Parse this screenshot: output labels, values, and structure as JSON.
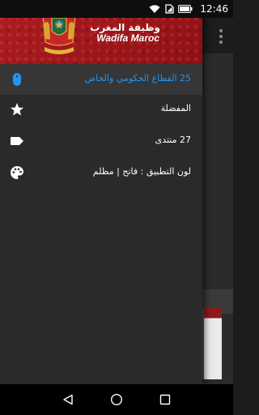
{
  "status_bar": {
    "time": "12:46",
    "icons": [
      "wifi-icon",
      "sim-signal-icon",
      "battery-icon"
    ]
  },
  "drawer": {
    "header": {
      "title_ar": "وظيفة المغرب",
      "title_en": "Wadifa Maroc",
      "logo": "coat-of-arms-icon"
    },
    "items": [
      {
        "label": "25  القطاع الحكومي والخاص",
        "icon": "mouse-icon",
        "selected": true
      },
      {
        "label": "المفضلة",
        "icon": "star-icon",
        "selected": false
      },
      {
        "label": "27  منتدى",
        "icon": "tag-icon",
        "selected": false
      },
      {
        "label": "لون التطبيق : فاتح | مظلم",
        "icon": "palette-icon",
        "selected": false
      }
    ]
  },
  "background_app": {
    "overflow_icon": "more-vert-icon"
  },
  "nav_bar": {
    "buttons": [
      "back-icon",
      "home-icon",
      "recents-icon"
    ]
  },
  "colors": {
    "header_red": "#a4161a",
    "accent_blue": "#2196f3",
    "drawer_bg": "#2a2a2a"
  }
}
